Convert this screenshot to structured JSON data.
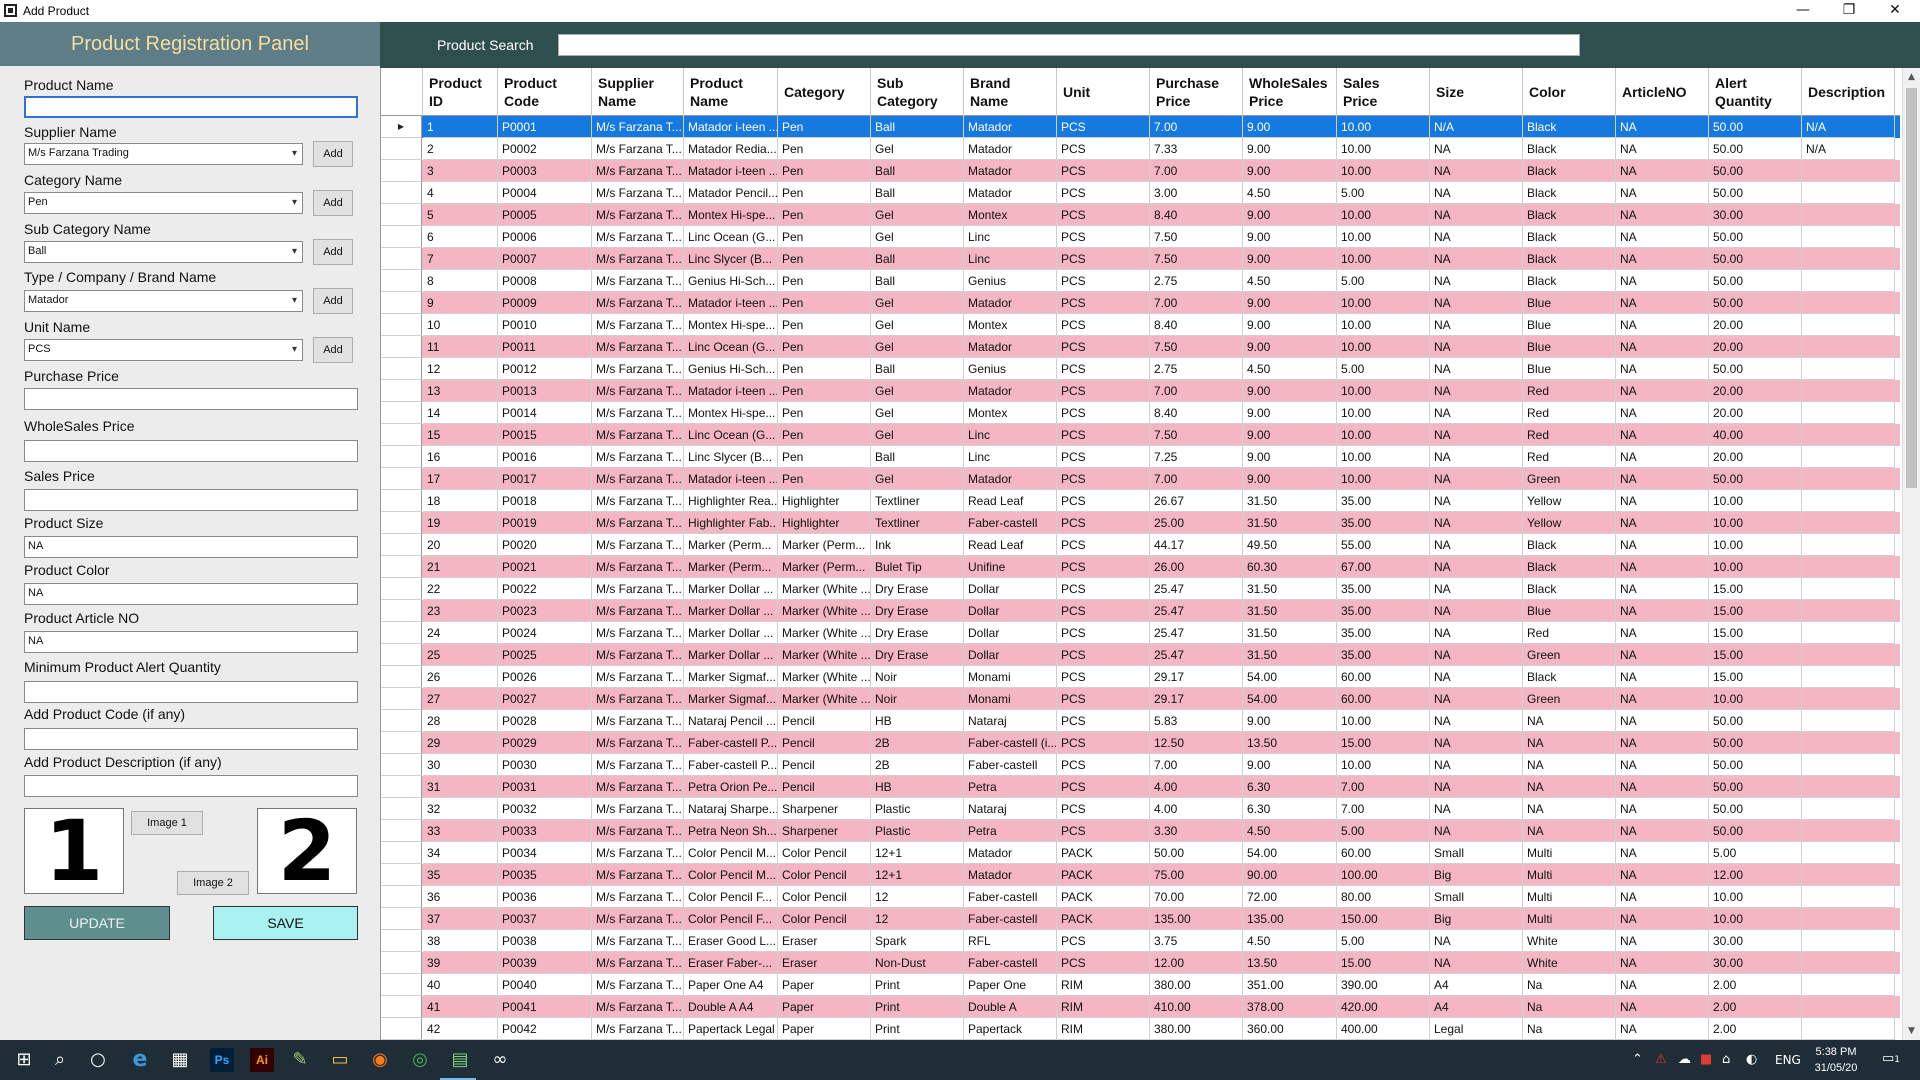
{
  "window": {
    "title": "Add Product",
    "minimize": "—",
    "restore": "❐",
    "close": "✕"
  },
  "panel": {
    "title": "Product Registration Panel",
    "fields": {
      "product_name_label": "Product Name",
      "product_name_value": "",
      "supplier_label": "Supplier Name",
      "supplier_value": "M/s Farzana Trading",
      "category_label": "Category Name",
      "category_value": "Pen",
      "subcategory_label": "Sub Category Name",
      "subcategory_value": "Ball",
      "brand_label": "Type / Company / Brand Name",
      "brand_value": "Matador",
      "unit_label": "Unit Name",
      "unit_value": "PCS",
      "purchase_label": "Purchase Price",
      "purchase_value": "",
      "wholesale_label": "WholeSales Price",
      "wholesale_value": "",
      "sales_label": "Sales Price",
      "sales_value": "",
      "size_label": "Product Size",
      "size_value": "NA",
      "color_label": "Product Color",
      "color_value": "NA",
      "article_label": "Product Article NO",
      "article_value": "NA",
      "alert_label": "Minimum Product Alert Quantity",
      "alert_value": "",
      "code_label": "Add Product Code (if any)",
      "code_value": "",
      "desc_label": "Add Product Description (if any)",
      "desc_value": ""
    },
    "add_label": "Add",
    "image1_preview": "1",
    "image2_preview": "2",
    "image1_button": "Image 1",
    "image2_button": "Image 2",
    "update_button": "UPDATE",
    "save_button": "SAVE"
  },
  "search": {
    "label": "Product Search",
    "value": ""
  },
  "grid": {
    "columns": [
      [
        "Product",
        "ID"
      ],
      [
        "Product",
        "Code"
      ],
      [
        "Supplier",
        "Name"
      ],
      [
        "Product",
        "Name"
      ],
      [
        "Category"
      ],
      [
        "Sub",
        "Category"
      ],
      [
        "Brand",
        "Name"
      ],
      [
        "Unit"
      ],
      [
        "Purchase",
        "Price"
      ],
      [
        "WholeSales",
        "Price"
      ],
      [
        "Sales",
        "Price"
      ],
      [
        "Size"
      ],
      [
        "Color"
      ],
      [
        "ArticleNO"
      ],
      [
        "Alert",
        "Quantity"
      ],
      [
        "Description"
      ]
    ],
    "selected_row_marker": "▶",
    "rows": [
      [
        "1",
        "P0001",
        "M/s Farzana T...",
        "Matador i-teen ...",
        "Pen",
        "Ball",
        "Matador",
        "PCS",
        "7.00",
        "9.00",
        "10.00",
        "N/A",
        "Black",
        "NA",
        "50.00",
        "N/A"
      ],
      [
        "2",
        "P0002",
        "M/s Farzana T...",
        "Matador Redia...",
        "Pen",
        "Gel",
        "Matador",
        "PCS",
        "7.33",
        "9.00",
        "10.00",
        "NA",
        "Black",
        "NA",
        "50.00",
        "N/A"
      ],
      [
        "3",
        "P0003",
        "M/s Farzana T...",
        "Matador i-teen ...",
        "Pen",
        "Ball",
        "Matador",
        "PCS",
        "7.00",
        "9.00",
        "10.00",
        "NA",
        "Black",
        "NA",
        "50.00",
        ""
      ],
      [
        "4",
        "P0004",
        "M/s Farzana T...",
        "Matador Pencil...",
        "Pen",
        "Ball",
        "Matador",
        "PCS",
        "3.00",
        "4.50",
        "5.00",
        "NA",
        "Black",
        "NA",
        "50.00",
        ""
      ],
      [
        "5",
        "P0005",
        "M/s Farzana T...",
        "Montex Hi-spe...",
        "Pen",
        "Gel",
        "Montex",
        "PCS",
        "8.40",
        "9.00",
        "10.00",
        "NA",
        "Black",
        "NA",
        "30.00",
        ""
      ],
      [
        "6",
        "P0006",
        "M/s Farzana T...",
        "Linc Ocean (G...",
        "Pen",
        "Gel",
        "Linc",
        "PCS",
        "7.50",
        "9.00",
        "10.00",
        "NA",
        "Black",
        "NA",
        "50.00",
        ""
      ],
      [
        "7",
        "P0007",
        "M/s Farzana T...",
        "Linc Slycer (B...",
        "Pen",
        "Ball",
        "Linc",
        "PCS",
        "7.50",
        "9.00",
        "10.00",
        "NA",
        "Black",
        "NA",
        "50.00",
        ""
      ],
      [
        "8",
        "P0008",
        "M/s Farzana T...",
        "Genius Hi-Sch...",
        "Pen",
        "Ball",
        "Genius",
        "PCS",
        "2.75",
        "4.50",
        "5.00",
        "NA",
        "Black",
        "NA",
        "50.00",
        ""
      ],
      [
        "9",
        "P0009",
        "M/s Farzana T...",
        "Matador i-teen ...",
        "Pen",
        "Gel",
        "Matador",
        "PCS",
        "7.00",
        "9.00",
        "10.00",
        "NA",
        "Blue",
        "NA",
        "50.00",
        ""
      ],
      [
        "10",
        "P0010",
        "M/s Farzana T...",
        "Montex Hi-spe...",
        "Pen",
        "Gel",
        "Montex",
        "PCS",
        "8.40",
        "9.00",
        "10.00",
        "NA",
        "Blue",
        "NA",
        "20.00",
        ""
      ],
      [
        "11",
        "P0011",
        "M/s Farzana T...",
        "Linc Ocean (G...",
        "Pen",
        "Gel",
        "Matador",
        "PCS",
        "7.50",
        "9.00",
        "10.00",
        "NA",
        "Blue",
        "NA",
        "20.00",
        ""
      ],
      [
        "12",
        "P0012",
        "M/s Farzana T...",
        "Genius Hi-Sch...",
        "Pen",
        "Ball",
        "Genius",
        "PCS",
        "2.75",
        "4.50",
        "5.00",
        "NA",
        "Blue",
        "NA",
        "50.00",
        ""
      ],
      [
        "13",
        "P0013",
        "M/s Farzana T...",
        "Matador i-teen ...",
        "Pen",
        "Gel",
        "Matador",
        "PCS",
        "7.00",
        "9.00",
        "10.00",
        "NA",
        "Red",
        "NA",
        "20.00",
        ""
      ],
      [
        "14",
        "P0014",
        "M/s Farzana T...",
        "Montex Hi-spe...",
        "Pen",
        "Gel",
        "Montex",
        "PCS",
        "8.40",
        "9.00",
        "10.00",
        "NA",
        "Red",
        "NA",
        "20.00",
        ""
      ],
      [
        "15",
        "P0015",
        "M/s Farzana T...",
        "Linc Ocean (G...",
        "Pen",
        "Gel",
        "Linc",
        "PCS",
        "7.50",
        "9.00",
        "10.00",
        "NA",
        "Red",
        "NA",
        "40.00",
        ""
      ],
      [
        "16",
        "P0016",
        "M/s Farzana T...",
        "Linc Slycer (B...",
        "Pen",
        "Ball",
        "Linc",
        "PCS",
        "7.25",
        "9.00",
        "10.00",
        "NA",
        "Red",
        "NA",
        "20.00",
        ""
      ],
      [
        "17",
        "P0017",
        "M/s Farzana T...",
        "Matador i-teen ...",
        "Pen",
        "Gel",
        "Matador",
        "PCS",
        "7.00",
        "9.00",
        "10.00",
        "NA",
        "Green",
        "NA",
        "50.00",
        ""
      ],
      [
        "18",
        "P0018",
        "M/s Farzana T...",
        "Highlighter Rea...",
        "Highlighter",
        "Textliner",
        "Read Leaf",
        "PCS",
        "26.67",
        "31.50",
        "35.00",
        "NA",
        "Yellow",
        "NA",
        "10.00",
        ""
      ],
      [
        "19",
        "P0019",
        "M/s Farzana T...",
        "Highlighter Fab...",
        "Highlighter",
        "Textliner",
        "Faber-castell",
        "PCS",
        "25.00",
        "31.50",
        "35.00",
        "NA",
        "Yellow",
        "NA",
        "10.00",
        ""
      ],
      [
        "20",
        "P0020",
        "M/s Farzana T...",
        "Marker (Perm...",
        "Marker (Perm...",
        "Ink",
        "Read Leaf",
        "PCS",
        "44.17",
        "49.50",
        "55.00",
        "NA",
        "Black",
        "NA",
        "10.00",
        ""
      ],
      [
        "21",
        "P0021",
        "M/s Farzana T...",
        "Marker (Perm...",
        "Marker (Perm...",
        "Bulet Tip",
        "Unifine",
        "PCS",
        "26.00",
        "60.30",
        "67.00",
        "NA",
        "Black",
        "NA",
        "10.00",
        ""
      ],
      [
        "22",
        "P0022",
        "M/s Farzana T...",
        "Marker Dollar ...",
        "Marker (White ...",
        "Dry Erase",
        "Dollar",
        "PCS",
        "25.47",
        "31.50",
        "35.00",
        "NA",
        "Black",
        "NA",
        "15.00",
        ""
      ],
      [
        "23",
        "P0023",
        "M/s Farzana T...",
        "Marker Dollar ...",
        "Marker (White ...",
        "Dry Erase",
        "Dollar",
        "PCS",
        "25.47",
        "31.50",
        "35.00",
        "NA",
        "Blue",
        "NA",
        "15.00",
        ""
      ],
      [
        "24",
        "P0024",
        "M/s Farzana T...",
        "Marker Dollar ...",
        "Marker (White ...",
        "Dry Erase",
        "Dollar",
        "PCS",
        "25.47",
        "31.50",
        "35.00",
        "NA",
        "Red",
        "NA",
        "15.00",
        ""
      ],
      [
        "25",
        "P0025",
        "M/s Farzana T...",
        "Marker Dollar ...",
        "Marker (White ...",
        "Dry Erase",
        "Dollar",
        "PCS",
        "25.47",
        "31.50",
        "35.00",
        "NA",
        "Green",
        "NA",
        "15.00",
        ""
      ],
      [
        "26",
        "P0026",
        "M/s Farzana T...",
        "Marker Sigmaf...",
        "Marker (White ...",
        "Noir",
        "Monami",
        "PCS",
        "29.17",
        "54.00",
        "60.00",
        "NA",
        "Black",
        "NA",
        "15.00",
        ""
      ],
      [
        "27",
        "P0027",
        "M/s Farzana T...",
        "Marker Sigmaf...",
        "Marker (White ...",
        "Noir",
        "Monami",
        "PCS",
        "29.17",
        "54.00",
        "60.00",
        "NA",
        "Green",
        "NA",
        "10.00",
        ""
      ],
      [
        "28",
        "P0028",
        "M/s Farzana T...",
        "Nataraj Pencil ...",
        "Pencil",
        "HB",
        "Nataraj",
        "PCS",
        "5.83",
        "9.00",
        "10.00",
        "NA",
        "NA",
        "NA",
        "50.00",
        ""
      ],
      [
        "29",
        "P0029",
        "M/s Farzana T...",
        "Faber-castell P...",
        "Pencil",
        "2B",
        "Faber-castell (i...",
        "PCS",
        "12.50",
        "13.50",
        "15.00",
        "NA",
        "NA",
        "NA",
        "50.00",
        ""
      ],
      [
        "30",
        "P0030",
        "M/s Farzana T...",
        "Faber-castell P...",
        "Pencil",
        "2B",
        "Faber-castell",
        "PCS",
        "7.00",
        "9.00",
        "10.00",
        "NA",
        "NA",
        "NA",
        "50.00",
        ""
      ],
      [
        "31",
        "P0031",
        "M/s Farzana T...",
        "Petra Orion Pe...",
        "Pencil",
        "HB",
        "Petra",
        "PCS",
        "4.00",
        "6.30",
        "7.00",
        "NA",
        "NA",
        "NA",
        "50.00",
        ""
      ],
      [
        "32",
        "P0032",
        "M/s Farzana T...",
        "Nataraj Sharpe...",
        "Sharpener",
        "Plastic",
        "Nataraj",
        "PCS",
        "4.00",
        "6.30",
        "7.00",
        "NA",
        "NA",
        "NA",
        "50.00",
        ""
      ],
      [
        "33",
        "P0033",
        "M/s Farzana T...",
        "Petra Neon Sh...",
        "Sharpener",
        "Plastic",
        "Petra",
        "PCS",
        "3.30",
        "4.50",
        "5.00",
        "NA",
        "NA",
        "NA",
        "50.00",
        ""
      ],
      [
        "34",
        "P0034",
        "M/s Farzana T...",
        "Color Pencil M...",
        "Color Pencil",
        "12+1",
        "Matador",
        "PACK",
        "50.00",
        "54.00",
        "60.00",
        "Small",
        "Multi",
        "NA",
        "5.00",
        ""
      ],
      [
        "35",
        "P0035",
        "M/s Farzana T...",
        "Color Pencil M...",
        "Color Pencil",
        "12+1",
        "Matador",
        "PACK",
        "75.00",
        "90.00",
        "100.00",
        "Big",
        "Multi",
        "NA",
        "12.00",
        ""
      ],
      [
        "36",
        "P0036",
        "M/s Farzana T...",
        "Color Pencil F...",
        "Color Pencil",
        "12",
        "Faber-castell",
        "PACK",
        "70.00",
        "72.00",
        "80.00",
        "Small",
        "Multi",
        "NA",
        "10.00",
        ""
      ],
      [
        "37",
        "P0037",
        "M/s Farzana T...",
        "Color Pencil F...",
        "Color Pencil",
        "12",
        "Faber-castell",
        "PACK",
        "135.00",
        "135.00",
        "150.00",
        "Big",
        "Multi",
        "NA",
        "10.00",
        ""
      ],
      [
        "38",
        "P0038",
        "M/s Farzana T...",
        "Eraser Good L...",
        "Eraser",
        "Spark",
        "RFL",
        "PCS",
        "3.75",
        "4.50",
        "5.00",
        "NA",
        "White",
        "NA",
        "30.00",
        ""
      ],
      [
        "39",
        "P0039",
        "M/s Farzana T...",
        "Eraser Faber-...",
        "Eraser",
        "Non-Dust",
        "Faber-castell",
        "PCS",
        "12.00",
        "13.50",
        "15.00",
        "NA",
        "White",
        "NA",
        "30.00",
        ""
      ],
      [
        "40",
        "P0040",
        "M/s Farzana T...",
        "Paper One A4",
        "Paper",
        "Print",
        "Paper One",
        "RIM",
        "380.00",
        "351.00",
        "390.00",
        "A4",
        "Na",
        "NA",
        "2.00",
        ""
      ],
      [
        "41",
        "P0041",
        "M/s Farzana T...",
        "Double A A4",
        "Paper",
        "Print",
        "Double A",
        "RIM",
        "410.00",
        "378.00",
        "420.00",
        "A4",
        "Na",
        "NA",
        "2.00",
        ""
      ],
      [
        "42",
        "P0042",
        "M/s Farzana T...",
        "Papertack Legal",
        "Paper",
        "Print",
        "Papertack",
        "RIM",
        "380.00",
        "360.00",
        "400.00",
        "Legal",
        "Na",
        "NA",
        "2.00",
        ""
      ]
    ],
    "selected_index": 0
  },
  "taskbar": {
    "apps": [
      {
        "name": "windows-start-icon",
        "glyph": "⊞"
      },
      {
        "name": "search-icon",
        "glyph": "⌕"
      },
      {
        "name": "cortana-icon",
        "glyph": "○"
      },
      {
        "name": "edge-icon",
        "glyph": "e"
      },
      {
        "name": "calculator-icon",
        "glyph": "▦"
      },
      {
        "name": "photoshop-icon",
        "glyph": "Ps"
      },
      {
        "name": "illustrator-icon",
        "glyph": "Ai"
      },
      {
        "name": "notepad-icon",
        "glyph": "✎"
      },
      {
        "name": "file-explorer-icon",
        "glyph": "▭"
      },
      {
        "name": "firefox-icon",
        "glyph": "◉"
      },
      {
        "name": "chrome-icon",
        "glyph": "◎"
      },
      {
        "name": "active-app-icon",
        "glyph": "▤"
      },
      {
        "name": "visual-studio-icon",
        "glyph": "∞"
      }
    ],
    "language": "ENG",
    "time": "5:38 PM",
    "date": "31/05/20",
    "notification_count": "1",
    "tray_glyphs": [
      "⌃",
      "⚠",
      "☁",
      "■",
      "⌂",
      "◐"
    ]
  }
}
